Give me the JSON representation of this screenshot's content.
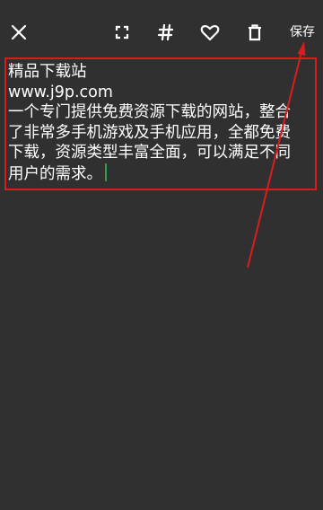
{
  "toolbar": {
    "close_icon": "close-icon",
    "fullscreen_icon": "fullscreen-icon",
    "hashtag_icon": "hashtag-icon",
    "favorite_icon": "heart-icon",
    "delete_icon": "trash-icon",
    "save_label": "保存"
  },
  "note": {
    "lines": [
      "精品下载站",
      "www.j9p.com",
      "一个专门提供免费资源下载的网站，整合",
      "了非常多手机游戏及手机应用，全都免费",
      "下载，资源类型丰富全面，可以满足不同",
      "用户的需求。"
    ]
  },
  "colors": {
    "background": "#303030",
    "text": "#ffffff",
    "annotation": "#d81d1d",
    "caret": "#2e9e4f"
  }
}
